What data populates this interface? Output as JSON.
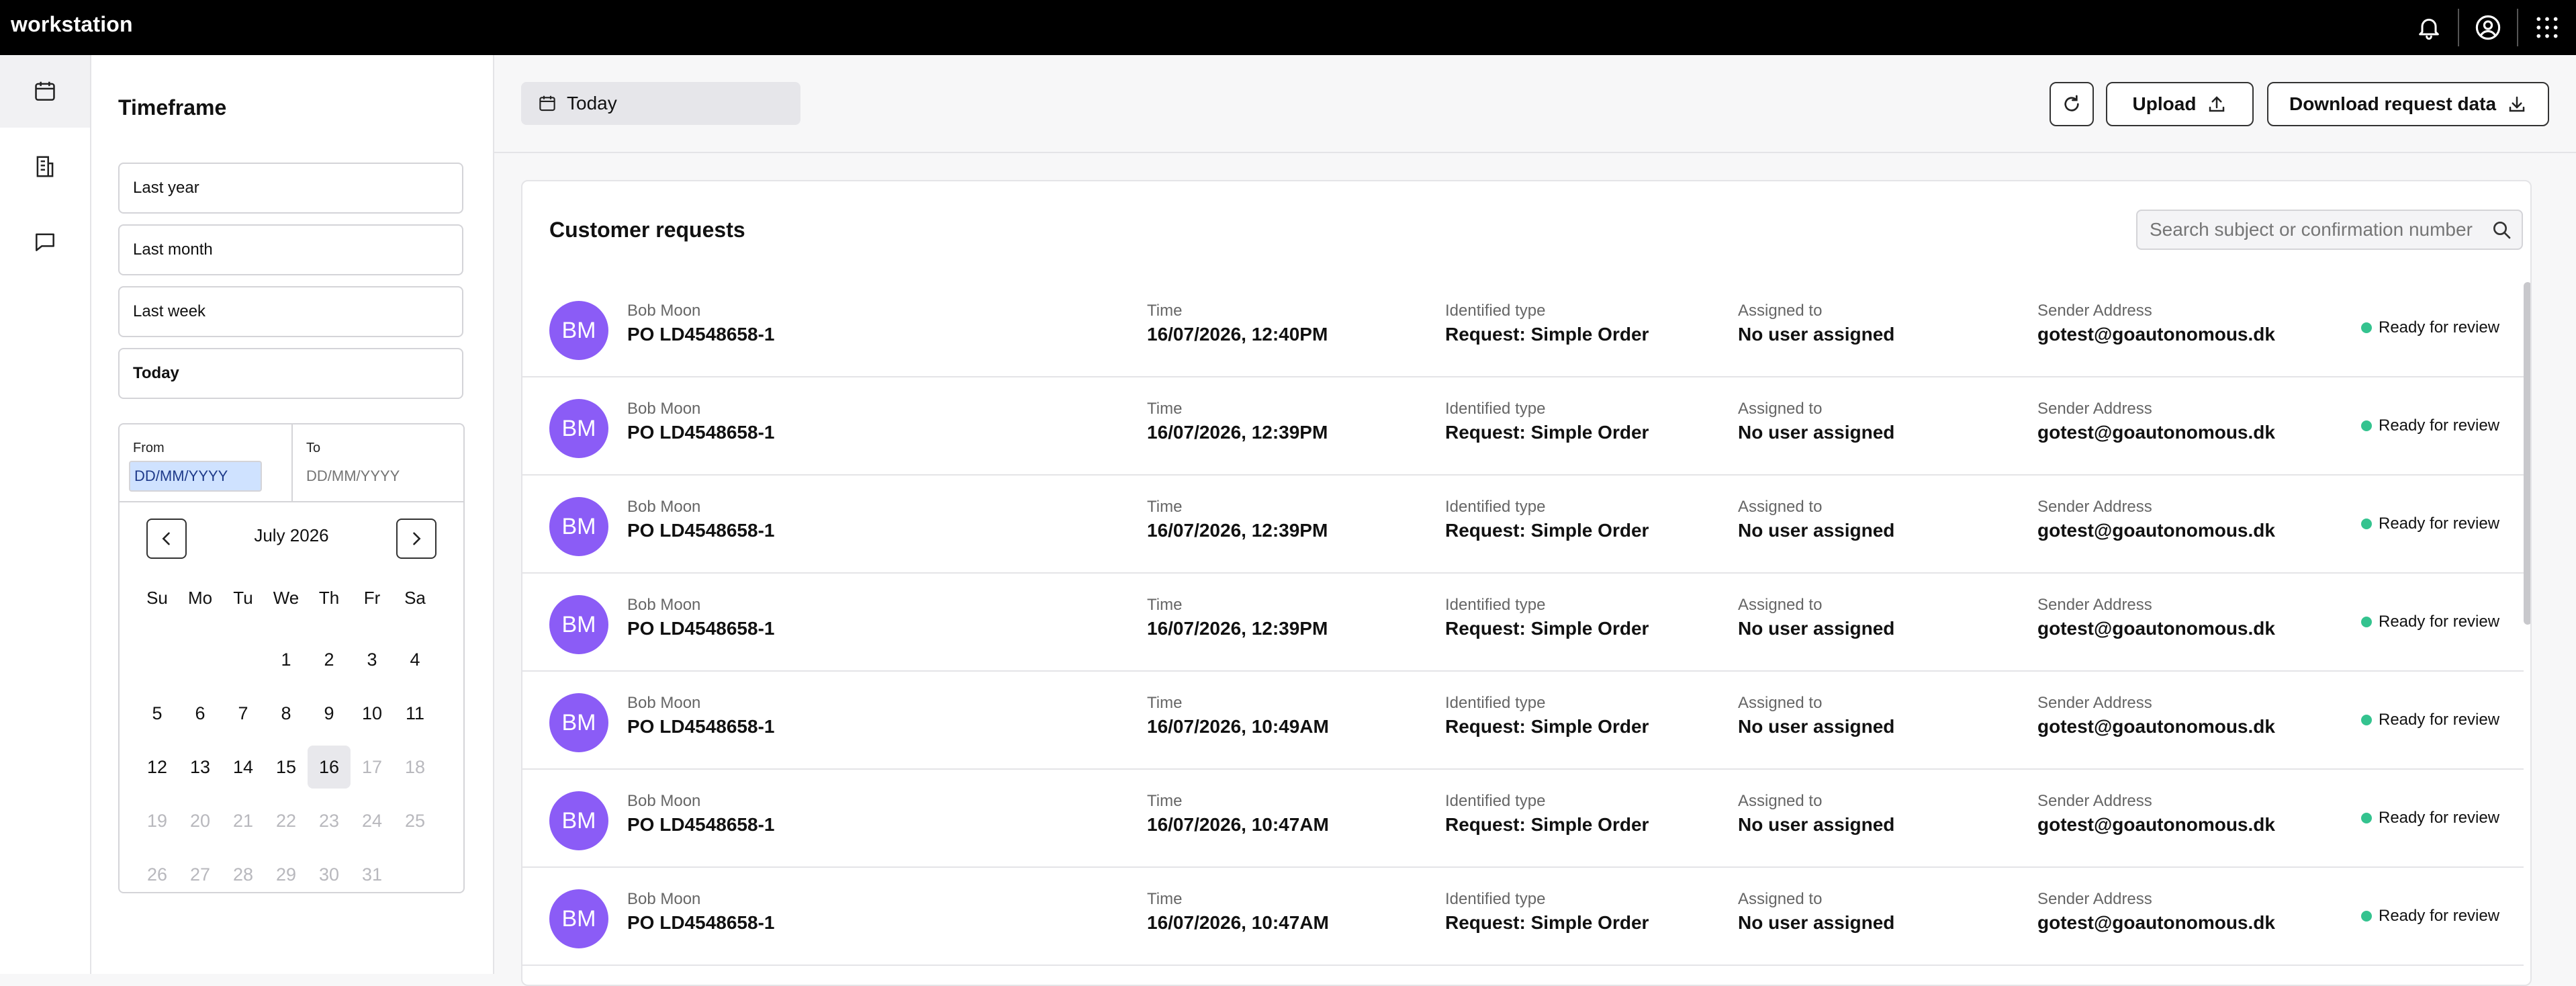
{
  "app": {
    "title": "workstation"
  },
  "topbar": {
    "icons": [
      "bell-icon",
      "account-icon",
      "apps-grid-icon"
    ]
  },
  "rail": {
    "items": [
      "calendar-icon",
      "document-icon",
      "chat-icon"
    ]
  },
  "timeframe": {
    "title": "Timeframe",
    "options": [
      "Last year",
      "Last month",
      "Last week",
      "Today"
    ],
    "selected": "Today",
    "from_label": "From",
    "from_value": "DD/MM/YYYY",
    "to_label": "To",
    "to_placeholder": "DD/MM/YYYY",
    "calendar": {
      "month": "July 2026",
      "weekdays": [
        "Su",
        "Mo",
        "Tu",
        "We",
        "Th",
        "Fr",
        "Sa"
      ],
      "today": "16"
    }
  },
  "toolbar": {
    "date_chip": "Today",
    "upload_label": "Upload",
    "download_label": "Download request data"
  },
  "requests": {
    "title": "Customer requests",
    "search_placeholder": "Search subject or confirmation number",
    "labels": {
      "time": "Time",
      "type": "Identified type",
      "assigned": "Assigned to",
      "sender": "Sender Address"
    },
    "rows": [
      {
        "initials": "BM",
        "name": "Bob Moon",
        "subject": "PO LD4548658-1",
        "time": "16/07/2026, 12:40PM",
        "type": "Request: Simple Order",
        "assigned": "No user assigned",
        "sender": "gotest@goautonomous.dk",
        "status": "Ready for review"
      },
      {
        "initials": "BM",
        "name": "Bob Moon",
        "subject": "PO LD4548658-1",
        "time": "16/07/2026, 12:39PM",
        "type": "Request: Simple Order",
        "assigned": "No user assigned",
        "sender": "gotest@goautonomous.dk",
        "status": "Ready for review"
      },
      {
        "initials": "BM",
        "name": "Bob Moon",
        "subject": "PO LD4548658-1",
        "time": "16/07/2026, 12:39PM",
        "type": "Request: Simple Order",
        "assigned": "No user assigned",
        "sender": "gotest@goautonomous.dk",
        "status": "Ready for review"
      },
      {
        "initials": "BM",
        "name": "Bob Moon",
        "subject": "PO LD4548658-1",
        "time": "16/07/2026, 12:39PM",
        "type": "Request: Simple Order",
        "assigned": "No user assigned",
        "sender": "gotest@goautonomous.dk",
        "status": "Ready for review"
      },
      {
        "initials": "BM",
        "name": "Bob Moon",
        "subject": "PO LD4548658-1",
        "time": "16/07/2026, 10:49AM",
        "type": "Request: Simple Order",
        "assigned": "No user assigned",
        "sender": "gotest@goautonomous.dk",
        "status": "Ready for review"
      },
      {
        "initials": "BM",
        "name": "Bob Moon",
        "subject": "PO LD4548658-1",
        "time": "16/07/2026, 10:47AM",
        "type": "Request: Simple Order",
        "assigned": "No user assigned",
        "sender": "gotest@goautonomous.dk",
        "status": "Ready for review"
      },
      {
        "initials": "BM",
        "name": "Bob Moon",
        "subject": "PO LD4548658-1",
        "time": "16/07/2026, 10:47AM",
        "type": "Request: Simple Order",
        "assigned": "No user assigned",
        "sender": "gotest@goautonomous.dk",
        "status": "Ready for review"
      }
    ]
  },
  "colors": {
    "avatar": "#8b5cf6",
    "status_ready": "#34c38f",
    "topbar": "#000000"
  }
}
